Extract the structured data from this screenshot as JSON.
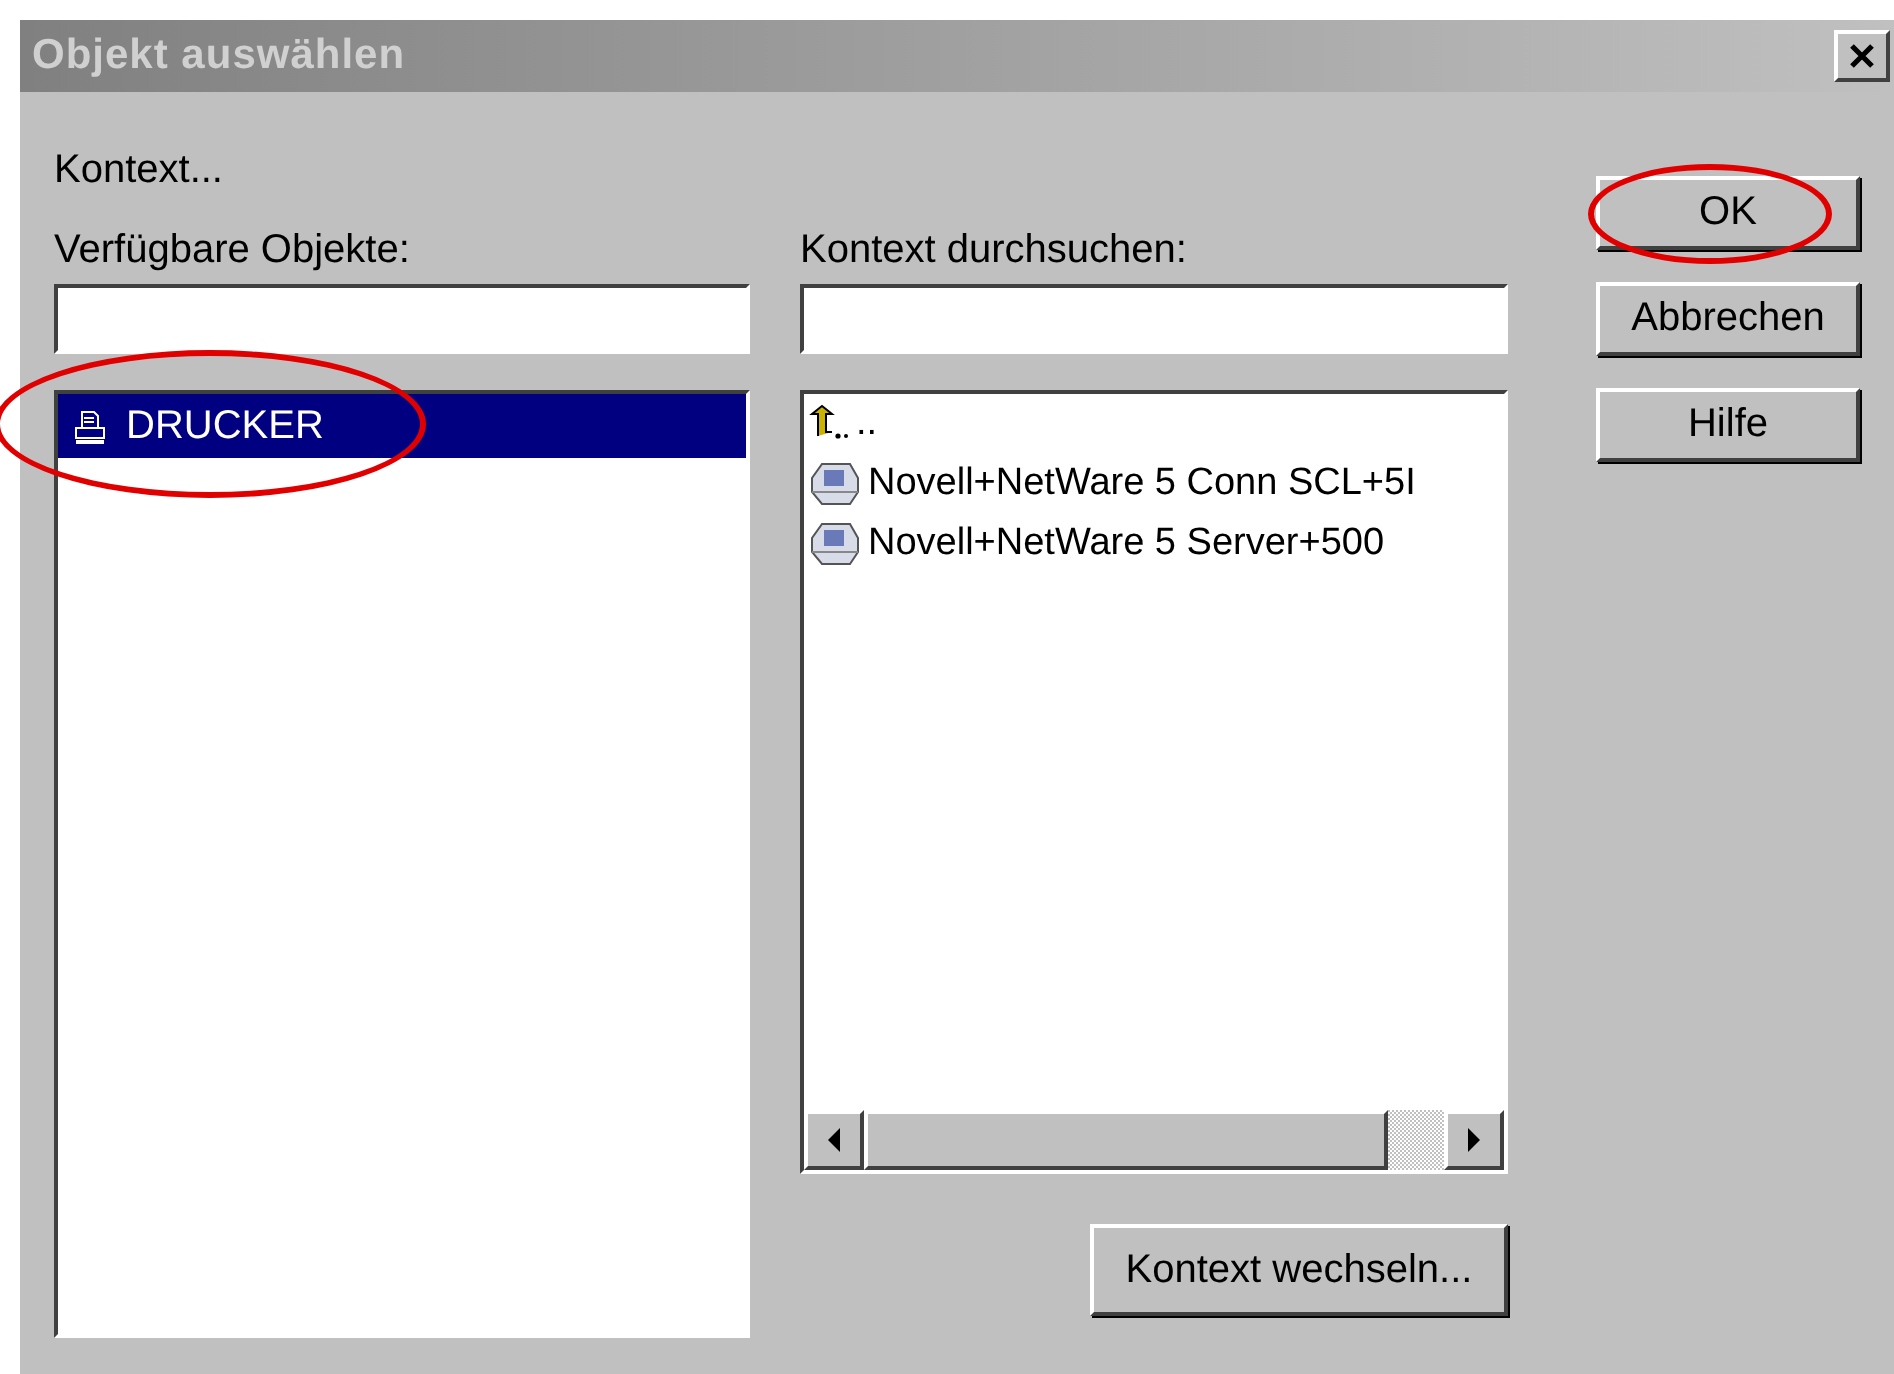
{
  "window": {
    "title": "Objekt auswählen",
    "active": false
  },
  "context_label": "Kontext...",
  "left": {
    "label": "Verfügbare Objekte:",
    "items": [
      {
        "label": "DRUCKER",
        "kind": "printer",
        "selected": true,
        "circled": true
      }
    ]
  },
  "middle": {
    "label": "Kontext durchsuchen:",
    "items": [
      {
        "label": "..",
        "kind": "parent",
        "selected": false,
        "circled": false
      },
      {
        "label": "Novell+NetWare 5 Conn SCL+5I",
        "kind": "server",
        "selected": false,
        "circled": false
      },
      {
        "label": "Novell+NetWare 5 Server+500",
        "kind": "server",
        "selected": false,
        "circled": false
      }
    ],
    "button": {
      "label": "Kontext wechseln...",
      "circled": false
    }
  },
  "buttons": [
    {
      "label": "OK",
      "circled": true
    },
    {
      "label": "Abbrechen",
      "circled": false
    },
    {
      "label": "Hilfe",
      "circled": false
    }
  ]
}
